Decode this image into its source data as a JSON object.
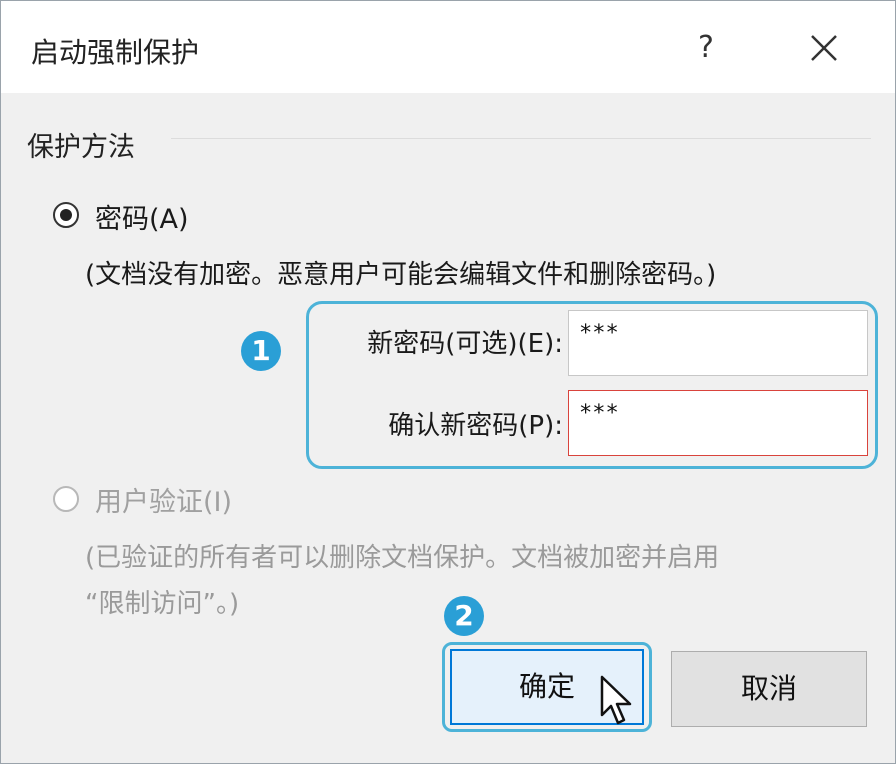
{
  "dialog": {
    "title": "启动强制保护",
    "help_label": "?",
    "close_icon": "close-icon"
  },
  "protection": {
    "group_title": "保护方法",
    "password_option": {
      "label": "密码(A)",
      "selected": true,
      "description": "(文档没有加密。恶意用户可能会编辑文件和删除密码。)"
    },
    "new_password": {
      "label": "新密码(可选)(E):",
      "value": "***"
    },
    "confirm_password": {
      "label": "确认新密码(P):",
      "value": "***"
    },
    "user_auth_option": {
      "label": "用户验证(I)",
      "selected": false,
      "description_line1": "(已验证的所有者可以删除文档保护。文档被加密并启用",
      "description_line2": "“限制访问”。)"
    }
  },
  "annotations": {
    "step1": "1",
    "step2": "2"
  },
  "buttons": {
    "ok": "确定",
    "cancel": "取消"
  },
  "colors": {
    "accent": "#2a9fd6",
    "highlight_outline": "#4db3d8",
    "primary_border": "#0078d7"
  }
}
